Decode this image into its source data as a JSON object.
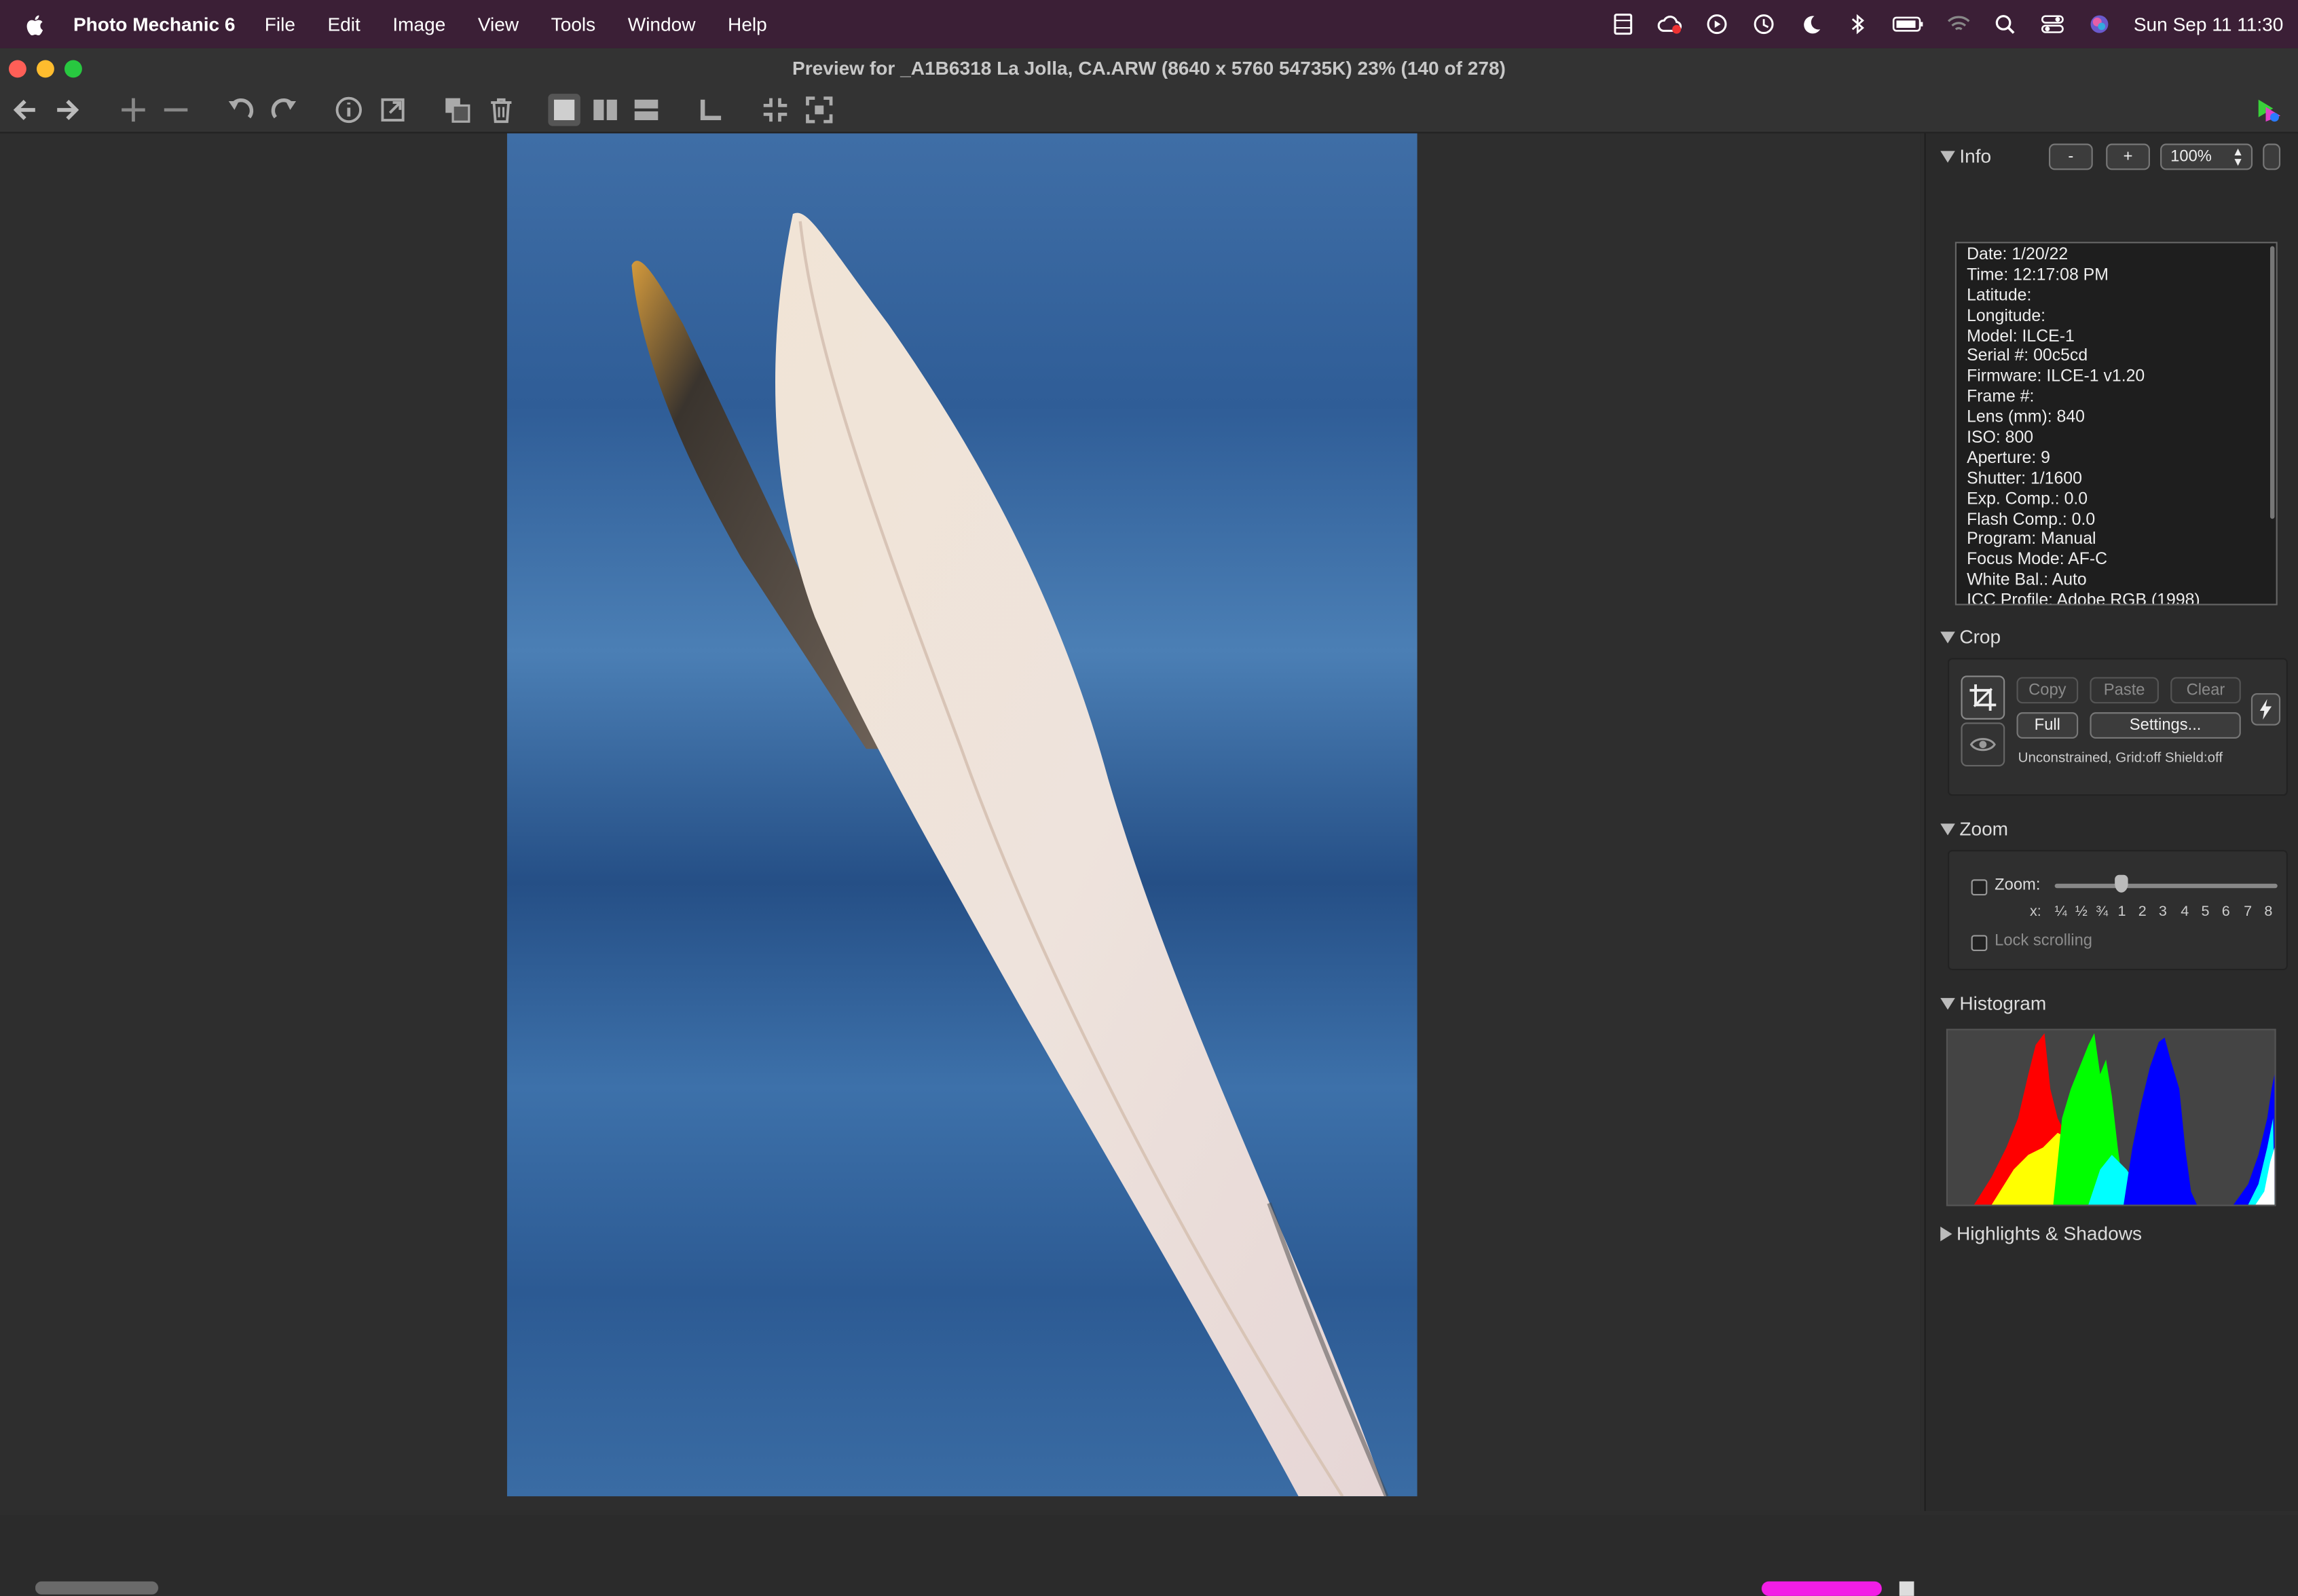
{
  "menubar": {
    "app_name": "Photo Mechanic 6",
    "items": [
      "File",
      "Edit",
      "Image",
      "View",
      "Tools",
      "Window",
      "Help"
    ],
    "clock": "Sun Sep 11  11:30",
    "status_icons": [
      "film-icon",
      "creative-cloud-icon",
      "play-circle-icon",
      "time-machine-icon",
      "moon-icon",
      "bluetooth-icon",
      "battery-icon",
      "wifi-icon",
      "search-icon",
      "control-center-icon",
      "siri-icon"
    ]
  },
  "window": {
    "title": "Preview for _A1B6318 La Jolla, CA.ARW (8640 x 5760 54735K) 23% (140 of 278)"
  },
  "toolbar": {
    "icons": [
      "back-arrow-icon",
      "forward-arrow-icon",
      "zoom-in-icon",
      "zoom-out-icon",
      "rotate-left-icon",
      "rotate-right-icon",
      "info-icon",
      "open-external-icon",
      "copy-icon",
      "trash-icon",
      "single-view-icon",
      "side-by-side-view-icon",
      "stacked-view-icon",
      "tag-icon",
      "fit-window-icon",
      "full-screen-icon"
    ]
  },
  "info": {
    "header": "Info",
    "minus_label": "-",
    "plus_label": "+",
    "zoom_value": "100%",
    "lines": [
      "Date: 1/20/22",
      "Time: 12:17:08 PM",
      "Latitude:",
      "Longitude:",
      "Model: ILCE-1",
      "Serial #: 00c5cd",
      "Firmware: ILCE-1 v1.20",
      "Frame #:",
      "Lens (mm): 840",
      "ISO: 800",
      "Aperture: 9",
      "Shutter: 1/1600",
      "Exp. Comp.: 0.0",
      "Flash Comp.: 0.0",
      "Program: Manual",
      "Focus Mode: AF-C",
      "White Bal.: Auto",
      "ICC Profile: Adobe RGB (1998)"
    ]
  },
  "crop": {
    "header": "Crop",
    "copy_label": "Copy",
    "paste_label": "Paste",
    "clear_label": "Clear",
    "full_label": "Full",
    "settings_label": "Settings...",
    "status": "Unconstrained, Grid:off Shield:off"
  },
  "zoom": {
    "header": "Zoom",
    "zoom_label": "Zoom:",
    "x_label": "x:",
    "ticks": [
      "¼",
      "½",
      "¾",
      "1",
      "2",
      "3",
      "4",
      "5",
      "6",
      "7",
      "8"
    ],
    "slider_value": 1,
    "lock_label": "Lock scrolling"
  },
  "histogram": {
    "header": "Histogram"
  },
  "highlights": {
    "header": "Highlights & Shadows"
  },
  "colors": {
    "menubar": "#3b1f36",
    "scroll_marker": "#f21ee6",
    "hist_red": "#ff0000",
    "hist_green": "#00ff00",
    "hist_blue": "#0000ff",
    "hist_yellow": "#ffff00",
    "hist_cyan": "#00ffff"
  }
}
